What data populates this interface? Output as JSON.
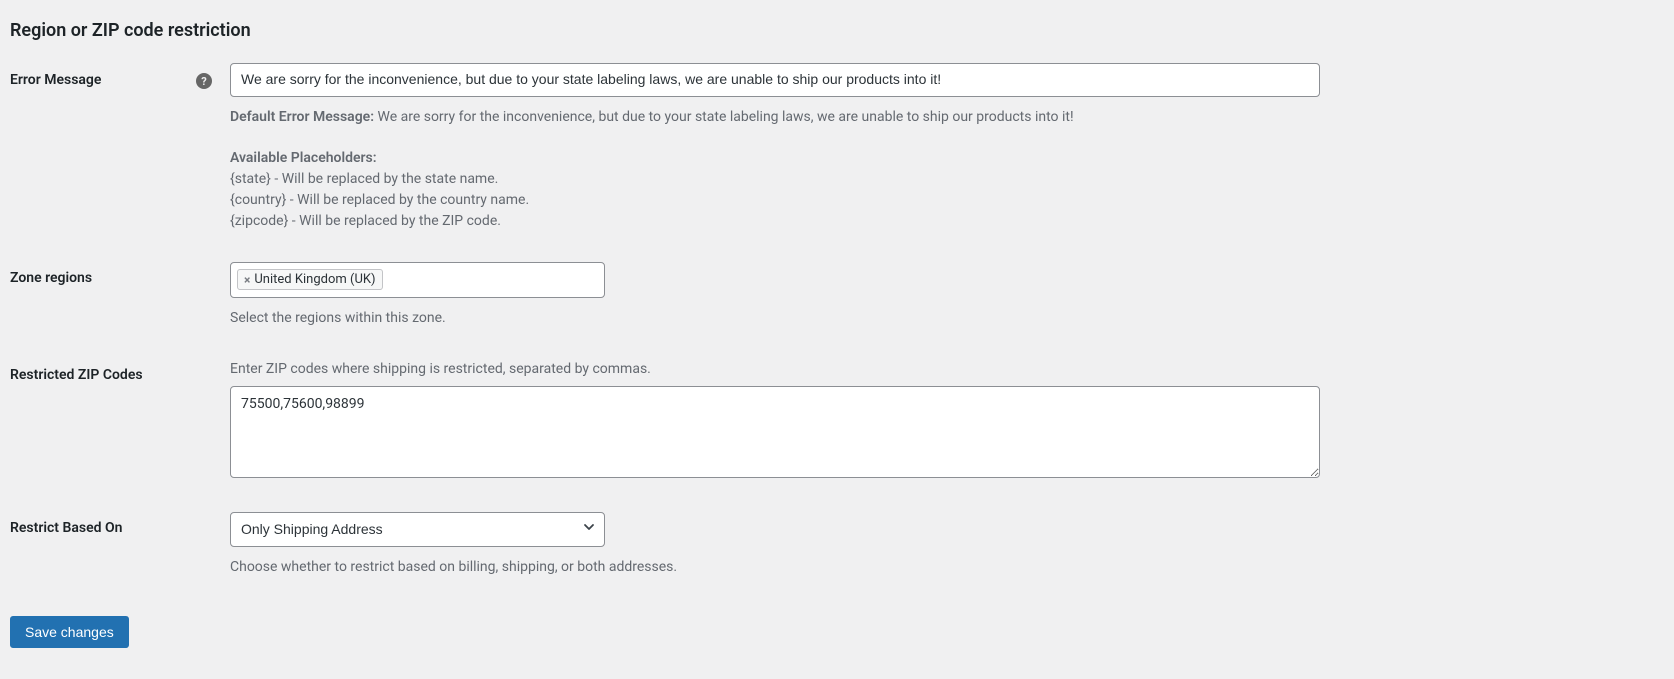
{
  "page": {
    "title": "Region or ZIP code restriction"
  },
  "errorMessage": {
    "label": "Error Message",
    "value": "We are sorry for the inconvenience, but due to your state labeling laws, we are unable to ship our products into it!",
    "defaultLabel": "Default Error Message:",
    "defaultText": " We are sorry for the inconvenience, but due to your state labeling laws, we are unable to ship our products into it!",
    "placeholdersLabel": "Available Placeholders:",
    "ph1": "{state} - Will be replaced by the state name.",
    "ph2": "{country} - Will be replaced by the country name.",
    "ph3": "{zipcode} - Will be replaced by the ZIP code."
  },
  "zoneRegions": {
    "label": "Zone regions",
    "tagLabel": "United Kingdom (UK)",
    "helper": "Select the regions within this zone."
  },
  "restrictedZip": {
    "label": "Restricted ZIP Codes",
    "preamble": "Enter ZIP codes where shipping is restricted, separated by commas.",
    "value": "75500,75600,98899"
  },
  "restrictBasedOn": {
    "label": "Restrict Based On",
    "value": "Only Shipping Address",
    "helper": "Choose whether to restrict based on billing, shipping, or both addresses."
  },
  "actions": {
    "save": "Save changes"
  }
}
